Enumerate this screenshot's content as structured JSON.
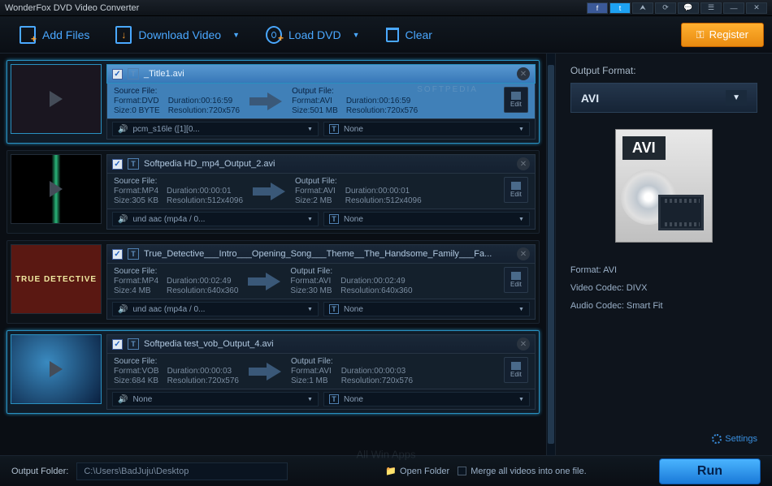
{
  "title": "WonderFox DVD Video Converter",
  "toolbar": {
    "add_files": "Add Files",
    "download_video": "Download Video",
    "load_dvd": "Load DVD",
    "clear": "Clear",
    "register": "Register"
  },
  "list": [
    {
      "filename": "_Title1.avi",
      "selected": true,
      "highlighted": true,
      "src": {
        "label": "Source File:",
        "format_k": "Format:",
        "format": "DVD",
        "dur_k": "Duration:",
        "dur": "00:16:59",
        "size_k": "Size:",
        "size": "0 BYTE",
        "res_k": "Resolution:",
        "res": "720x576"
      },
      "out": {
        "label": "Output File:",
        "format_k": "Format:",
        "format": "AVI",
        "dur_k": "Duration:",
        "dur": "00:16:59",
        "size_k": "Size:",
        "size": "501 MB",
        "res_k": "Resolution:",
        "res": "720x576"
      },
      "audio": "pcm_s16le ([1][0...",
      "sub": "None",
      "edit": "Edit"
    },
    {
      "filename": "Softpedia HD_mp4_Output_2.avi",
      "src": {
        "label": "Source File:",
        "format_k": "Format:",
        "format": "MP4",
        "dur_k": "Duration:",
        "dur": "00:00:01",
        "size_k": "Size:",
        "size": "305 KB",
        "res_k": "Resolution:",
        "res": "512x4096"
      },
      "out": {
        "label": "Output File:",
        "format_k": "Format:",
        "format": "AVI",
        "dur_k": "Duration:",
        "dur": "00:00:01",
        "size_k": "Size:",
        "size": "2 MB",
        "res_k": "Resolution:",
        "res": "512x4096"
      },
      "audio": "und aac (mp4a / 0...",
      "sub": "None",
      "edit": "Edit"
    },
    {
      "filename": "True_Detective___Intro___Opening_Song___Theme__The_Handsome_Family___Fa...",
      "thumbtext": "TRUE DETECTIVE",
      "src": {
        "label": "Source File:",
        "format_k": "Format:",
        "format": "MP4",
        "dur_k": "Duration:",
        "dur": "00:02:49",
        "size_k": "Size:",
        "size": "4 MB",
        "res_k": "Resolution:",
        "res": "640x360"
      },
      "out": {
        "label": "Output File:",
        "format_k": "Format:",
        "format": "AVI",
        "dur_k": "Duration:",
        "dur": "00:02:49",
        "size_k": "Size:",
        "size": "30 MB",
        "res_k": "Resolution:",
        "res": "640x360"
      },
      "audio": "und aac (mp4a / 0...",
      "sub": "None",
      "edit": "Edit"
    },
    {
      "filename": "Softpedia test_vob_Output_4.avi",
      "selected": true,
      "src": {
        "label": "Source File:",
        "format_k": "Format:",
        "format": "VOB",
        "dur_k": "Duration:",
        "dur": "00:00:03",
        "size_k": "Size:",
        "size": "684 KB",
        "res_k": "Resolution:",
        "res": "720x576"
      },
      "out": {
        "label": "Output File:",
        "format_k": "Format:",
        "format": "AVI",
        "dur_k": "Duration:",
        "dur": "00:00:03",
        "size_k": "Size:",
        "size": "1 MB",
        "res_k": "Resolution:",
        "res": "720x576"
      },
      "audio": "None",
      "sub": "None",
      "edit": "Edit"
    }
  ],
  "side": {
    "label": "Output Format:",
    "format": "AVI",
    "badge": "AVI",
    "meta_format": "Format: AVI",
    "meta_vcodec": "Video Codec: DIVX",
    "meta_acodec": "Audio Codec: Smart Fit",
    "settings": "Settings"
  },
  "footer": {
    "label": "Output Folder:",
    "path": "C:\\Users\\BadJuju\\Desktop",
    "open": "Open Folder",
    "merge": "Merge all videos into one file.",
    "run": "Run"
  },
  "watermark_soft": "SOFTPEDIA",
  "watermark_site": "All Win Apps"
}
